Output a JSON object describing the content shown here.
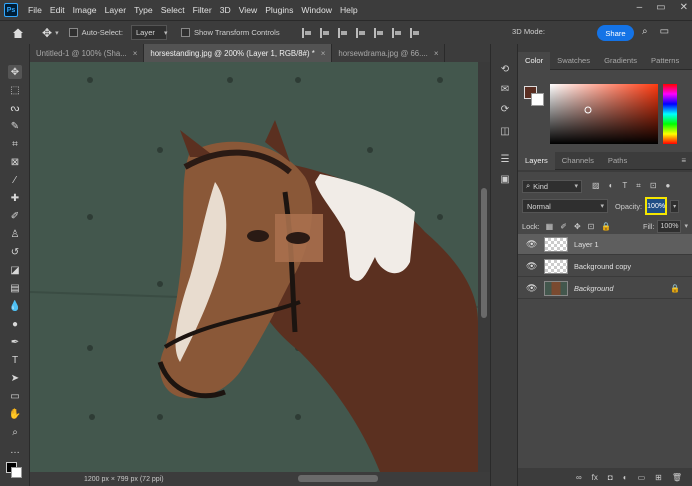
{
  "app": {
    "logo": "Ps"
  },
  "menu": [
    "File",
    "Edit",
    "Image",
    "Layer",
    "Type",
    "Select",
    "Filter",
    "3D",
    "View",
    "Plugins",
    "Window",
    "Help"
  ],
  "options": {
    "auto_select_label": "Auto-Select:",
    "auto_select_value": "Layer",
    "show_transform_label": "Show Transform Controls",
    "mode_3d_label": "3D Mode:",
    "share_label": "Share"
  },
  "tabs": [
    {
      "label": "Untitled-1 @ 100% (Sha..."
    },
    {
      "label": "horsestanding.jpg @ 200% (Layer 1, RGB/8#) *"
    },
    {
      "label": "horsewdrama.jpg @ 66...."
    }
  ],
  "status": {
    "doc_info": "1200 px × 799 px (72 ppi)"
  },
  "color_panel": {
    "tabs": [
      "Color",
      "Swatches",
      "Gradients",
      "Patterns"
    ],
    "foreground": "#5a2e22",
    "background": "#ffffff"
  },
  "layers_panel": {
    "tabs": [
      "Layers",
      "Channels",
      "Paths"
    ],
    "kind_label": "Kind",
    "blend_mode": "Normal",
    "opacity_label": "Opacity:",
    "opacity_value": "100%",
    "lock_label": "Lock:",
    "fill_label": "Fill:",
    "fill_value": "100%",
    "layers": [
      {
        "name": "Layer 1",
        "selected": true
      },
      {
        "name": "Background copy",
        "selected": false
      },
      {
        "name": "Background",
        "selected": false,
        "locked": true
      }
    ]
  },
  "colors": {
    "accent": "#1473e6",
    "highlight": "#f5e600",
    "canvas_bg": "#43574d"
  }
}
